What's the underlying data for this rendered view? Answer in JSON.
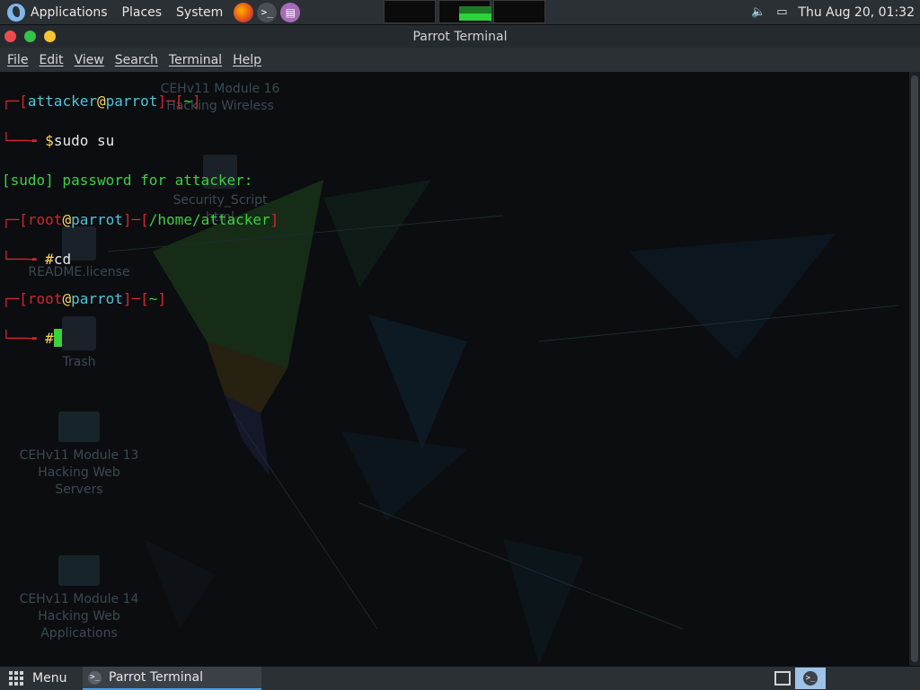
{
  "top_panel": {
    "applications": "Applications",
    "places": "Places",
    "system": "System",
    "launchers": [
      "firefox-icon",
      "terminal-icon",
      "text-editor-icon"
    ],
    "clock": "Thu Aug 20, 01:32"
  },
  "window": {
    "title": "Parrot Terminal",
    "menu": [
      "File",
      "Edit",
      "View",
      "Search",
      "Terminal",
      "Help"
    ]
  },
  "terminal": {
    "lines": [
      {
        "open": "┌─[",
        "user": "attacker",
        "at": "@",
        "host": "parrot",
        "mid": "]─[",
        "path": "~",
        "close": "]"
      },
      {
        "prefix": "└──╼ ",
        "sym": "$",
        "cmd": "sudo su"
      },
      {
        "text": "[sudo] password for attacker:"
      },
      {
        "open": "┌─[",
        "user": "root",
        "at": "@",
        "host": "parrot",
        "mid": "]─[",
        "path": "/home/attacker",
        "close": "]"
      },
      {
        "prefix": "└──╼ ",
        "sym": "#",
        "cmd": "cd"
      },
      {
        "open": "┌─[",
        "user": "root",
        "at": "@",
        "host": "parrot",
        "mid": "]─[",
        "path": "~",
        "close": "]"
      },
      {
        "prefix": "└──╼ ",
        "sym": "#",
        "cmd": ""
      }
    ]
  },
  "desktop_icons": [
    {
      "label": "CEHv11 Module 16\nHacking Wireless"
    },
    {
      "label": "Security_Script\nhtml"
    },
    {
      "label": "README.license"
    },
    {
      "label": "Trash"
    },
    {
      "label": "CEHv11 Module 13\nHacking Web\nServers"
    },
    {
      "label": "CEHv11 Module 14\nHacking Web\nApplications"
    }
  ],
  "bottom_panel": {
    "menu": "Menu",
    "task": "Parrot Terminal"
  },
  "colors": {
    "prompt_red": "#d4262e",
    "prompt_cyan": "#4fc7d9",
    "prompt_yellow": "#ffd85b",
    "text_green": "#3cd23c"
  }
}
